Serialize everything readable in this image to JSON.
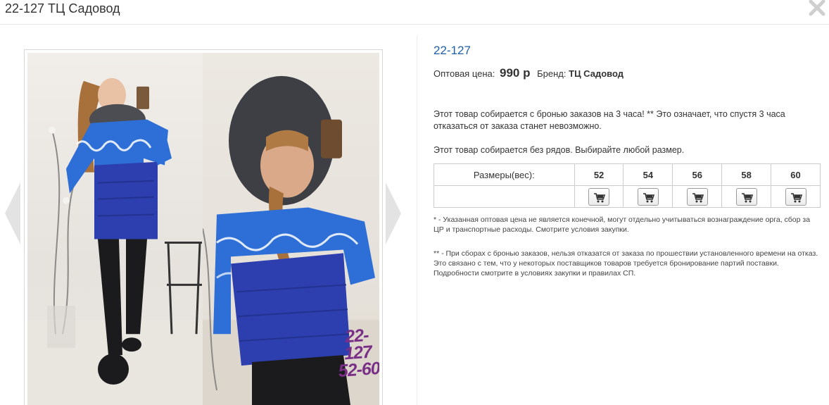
{
  "header": {
    "title": "22-127 ТЦ Садовод"
  },
  "gallery": {
    "prev_icon": "chevron-left-icon",
    "next_icon": "chevron-right-icon",
    "image_sign": [
      "22-127",
      "52-60"
    ]
  },
  "product": {
    "code": "22-127",
    "price_label": "Оптовая цена:",
    "price": "990 р",
    "brand_label": "Бренд:",
    "brand": "ТЦ Садовод",
    "notice_booking": "Этот товар собирается с бронью заказов на 3 часа! ** Это означает, что спустя 3 часа отказаться от заказа станет невозможно.",
    "notice_rows": "Этот товар собирается без рядов. Выбирайте любой размер."
  },
  "sizes_table": {
    "label": "Размеры(вес):",
    "sizes": [
      "52",
      "54",
      "56",
      "58",
      "60"
    ],
    "cart_icon": "cart-icon"
  },
  "footnotes": [
    "* - Указанная оптовая цена не является конечной, могут отдельно учитываться вознаграждение орга, сбор за ЦР и транспортные расходы. Смотрите условия закупки.",
    "** - При сборах с бронью заказов, нельзя отказатся от заказа по прошествии установленного времени на отказ. Это связано с тем, что у некоторых поставщиков товаров требуется бронирование партий поставки. Подробности смотрите в условиях закупки и правилах СП."
  ],
  "colors": {
    "link": "#1f5fa8",
    "jacket_blue": "#2d3fae",
    "sign_purple": "#7a2f86"
  }
}
